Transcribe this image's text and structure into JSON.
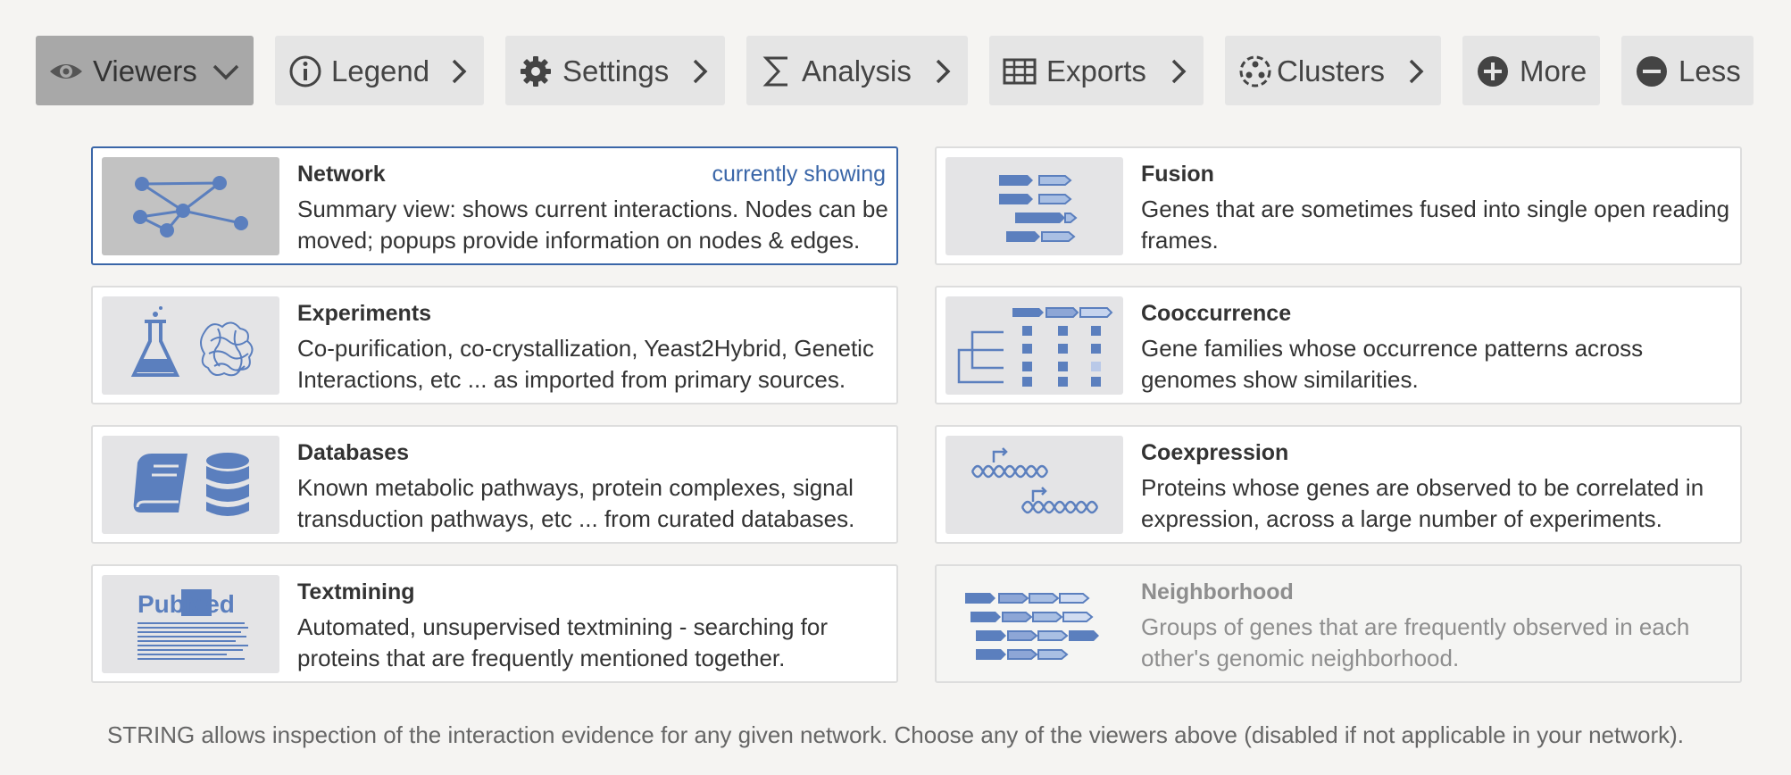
{
  "toolbar": {
    "buttons": [
      {
        "label": "Viewers",
        "icon": "eye-icon",
        "indicator": "chevron-down-icon",
        "active": true
      },
      {
        "label": "Legend",
        "icon": "info-icon",
        "indicator": "chevron-right-icon",
        "active": false
      },
      {
        "label": "Settings",
        "icon": "gear-icon",
        "indicator": "chevron-right-icon",
        "active": false
      },
      {
        "label": "Analysis",
        "icon": "sigma-icon",
        "indicator": "chevron-right-icon",
        "active": false
      },
      {
        "label": "Exports",
        "icon": "table-icon",
        "indicator": "chevron-right-icon",
        "active": false
      },
      {
        "label": "Clusters",
        "icon": "clusters-icon",
        "indicator": "chevron-right-icon",
        "active": false
      },
      {
        "label": "More",
        "icon": "plus-circle-icon",
        "active": false
      },
      {
        "label": "Less",
        "icon": "minus-circle-icon",
        "active": false
      }
    ]
  },
  "viewers": [
    {
      "title": "Network",
      "status": "currently showing",
      "description": "Summary view: shows current interactions. Nodes can be moved; popups provide information on nodes & edges.",
      "icon": "network-graph-icon",
      "selected": true,
      "disabled": false
    },
    {
      "title": "Fusion",
      "description": "Genes that are sometimes fused into single open reading frames.",
      "icon": "gene-fusion-icon",
      "selected": false,
      "disabled": false
    },
    {
      "title": "Experiments",
      "description": "Co-purification, co-crystallization, Yeast2Hybrid, Genetic Interactions, etc ... as imported from primary sources.",
      "icon": "flask-protein-icon",
      "selected": false,
      "disabled": false
    },
    {
      "title": "Cooccurrence",
      "description": "Gene families whose occurrence patterns across genomes show similarities.",
      "icon": "phylogenetic-matrix-icon",
      "selected": false,
      "disabled": false
    },
    {
      "title": "Databases",
      "description": "Known metabolic pathways, protein complexes, signal transduction pathways, etc ... from curated databases.",
      "icon": "book-database-icon",
      "selected": false,
      "disabled": false
    },
    {
      "title": "Coexpression",
      "description": "Proteins whose genes are observed to be correlated in expression, across a large number of experiments.",
      "icon": "dna-expression-icon",
      "selected": false,
      "disabled": false
    },
    {
      "title": "Textmining",
      "description": "Automated, unsupervised textmining - searching for proteins that are frequently mentioned together.",
      "icon": "pubmed-logo-icon",
      "logo_text": "PubMed",
      "selected": false,
      "disabled": false
    },
    {
      "title": "Neighborhood",
      "description": "Groups of genes that are frequently observed in each other's genomic neighborhood.",
      "icon": "gene-neighborhood-icon",
      "selected": false,
      "disabled": true
    }
  ],
  "footer": "STRING allows inspection of the interaction evidence for any given network. Choose any of the viewers above (disabled if not applicable in your network).",
  "colors": {
    "accent": "#3a66a8",
    "icon_blue": "#5b7fbe",
    "button_bg": "#e5e5e5",
    "button_active_bg": "#a8a8a8",
    "page_bg": "#f5f4f2"
  }
}
